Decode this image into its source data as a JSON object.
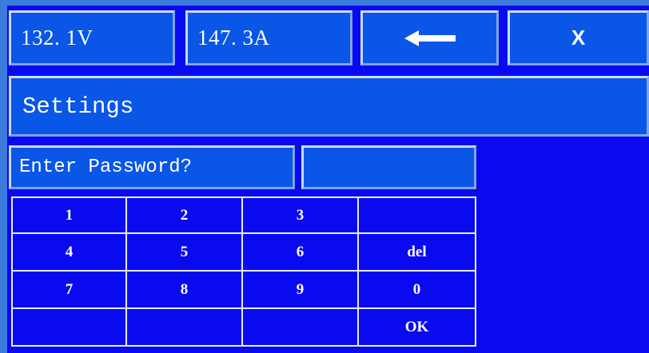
{
  "header": {
    "voltage": "132. 1V",
    "current": "147. 3A",
    "back_icon": "left-arrow-icon",
    "close_label": "X"
  },
  "title": "Settings",
  "password": {
    "prompt": "Enter Password?",
    "value": ""
  },
  "keypad": {
    "keys": [
      "1",
      "2",
      "3",
      "",
      "4",
      "5",
      "6",
      "del",
      "7",
      "8",
      "9",
      "0",
      "",
      "",
      "",
      "OK"
    ]
  },
  "colors": {
    "background": "#0a0af0",
    "field": "#0a56e6",
    "frame": "#3b7bdc",
    "text": "#ffffff"
  }
}
